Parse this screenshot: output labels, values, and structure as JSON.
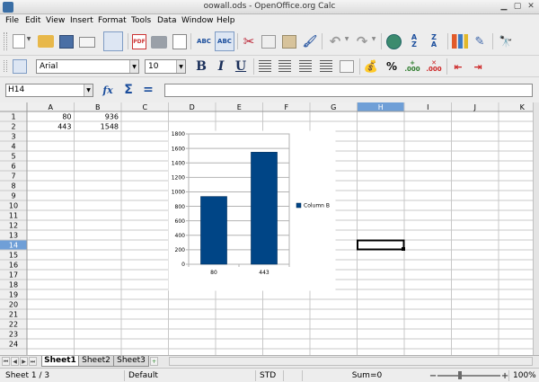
{
  "window": {
    "title": "oowall.ods - OpenOffice.org Calc"
  },
  "menu": [
    "File",
    "Edit",
    "View",
    "Insert",
    "Format",
    "Tools",
    "Data",
    "Window",
    "Help"
  ],
  "toolbar2": {
    "font_name": "Arial",
    "font_size": "10",
    "bold": "B",
    "italic": "I",
    "underline": "U"
  },
  "formula_bar": {
    "cell_ref": "H14",
    "content": ""
  },
  "grid": {
    "columns": [
      "A",
      "B",
      "C",
      "D",
      "E",
      "F",
      "G",
      "H",
      "I",
      "J",
      "K"
    ],
    "rows": [
      "1",
      "2",
      "3",
      "4",
      "5",
      "6",
      "7",
      "8",
      "9",
      "10",
      "11",
      "12",
      "13",
      "14",
      "15",
      "16",
      "17",
      "18",
      "19",
      "20",
      "21",
      "22",
      "23",
      "24"
    ],
    "cells": [
      {
        "col": "A",
        "row": "1",
        "value": "80"
      },
      {
        "col": "B",
        "row": "1",
        "value": "936"
      },
      {
        "col": "A",
        "row": "2",
        "value": "443"
      },
      {
        "col": "B",
        "row": "2",
        "value": "1548"
      }
    ],
    "selected": {
      "col": "H",
      "row": "14"
    }
  },
  "chart_data": {
    "type": "bar",
    "categories": [
      "80",
      "443"
    ],
    "series": [
      {
        "name": "Column B",
        "values": [
          936,
          1548
        ],
        "color": "#004586"
      }
    ],
    "y_ticks": [
      "0",
      "200",
      "400",
      "600",
      "800",
      "1000",
      "1200",
      "1400",
      "1600",
      "1800"
    ],
    "ylim": [
      0,
      1800
    ],
    "grid": true,
    "legend_position": "right"
  },
  "sheet_tabs": [
    "Sheet1",
    "Sheet2",
    "Sheet3"
  ],
  "active_sheet": "Sheet1",
  "statusbar": {
    "sheet_info": "Sheet 1 / 3",
    "page_style": "Default",
    "mode": "STD",
    "sum": "Sum=0",
    "zoom": "100%"
  },
  "colors": {
    "header_bg": "#efefef",
    "selected_header": "#6f9fd7",
    "grid_line": "#c8c8c8"
  }
}
